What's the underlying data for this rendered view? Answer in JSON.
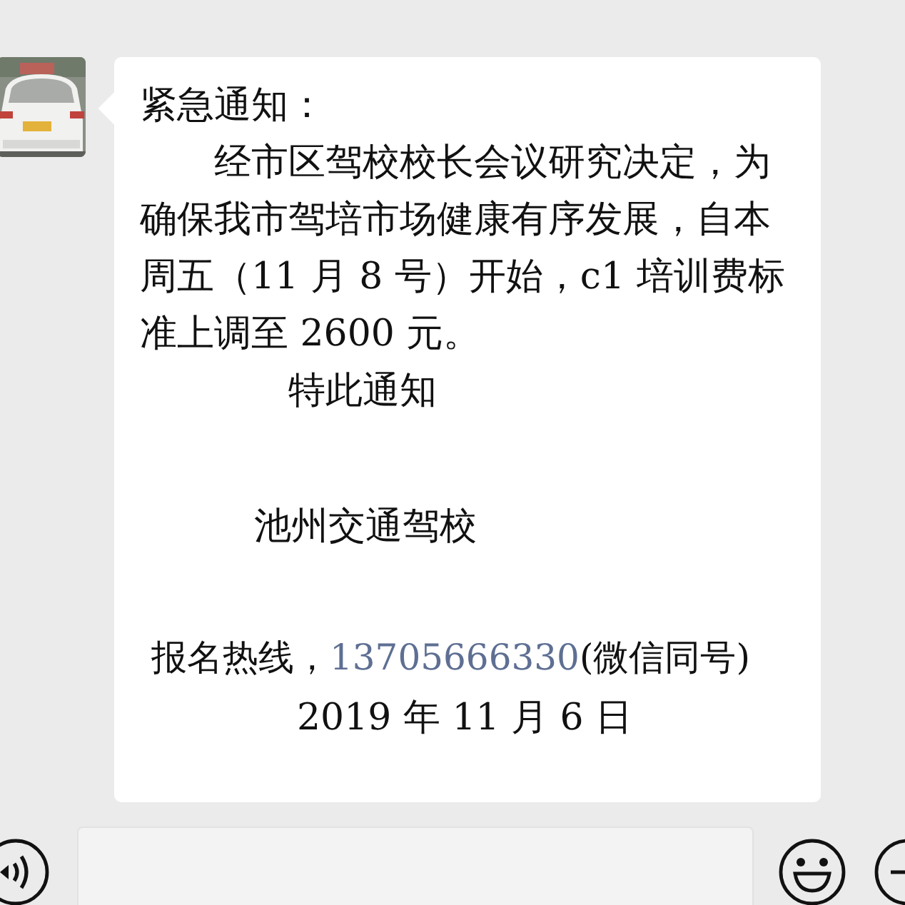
{
  "message": {
    "title": "紧急通知：",
    "body": "经市区驾校校长会议研究决定，为确保我市驾培市场健康有序发展，自本周五（11 月 8 号）开始，c1 培训费标准上调至 2600 元。",
    "closing": "特此通知",
    "sender": "池州交通驾校",
    "hotline_label": "报名热线，",
    "hotline_number": "13705666330",
    "hotline_note": "(微信同号)",
    "date": "2019 年 11 月 6 日"
  },
  "input_bar": {
    "kind": "text"
  }
}
